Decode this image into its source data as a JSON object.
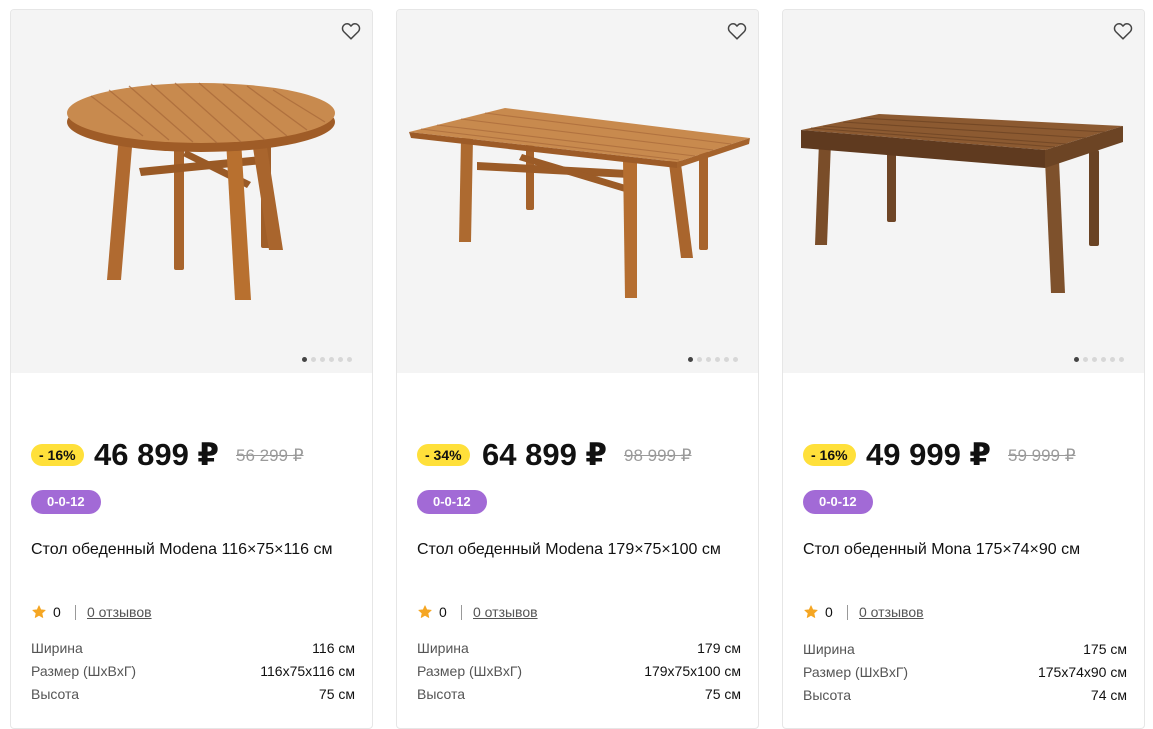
{
  "cards": [
    {
      "discount": "- 16%",
      "price": "46 899 ₽",
      "old_price": "56 299 ₽",
      "installment": "0-0-12",
      "title": "Стол обеденный Modena 116×75×116 см",
      "rating": "0",
      "reviews": "0 отзывов",
      "specs": [
        {
          "key": "Ширина",
          "value": "116 см"
        },
        {
          "key": "Размер (ШxВxГ)",
          "value": "116x75x116 см"
        },
        {
          "key": "Высота",
          "value": "75 см"
        }
      ],
      "image_icon": "round-wooden-table-image",
      "slides": 6,
      "active_slide": 1
    },
    {
      "discount": "- 34%",
      "price": "64 899 ₽",
      "old_price": "98 999 ₽",
      "installment": "0-0-12",
      "title": "Стол обеденный Modena 179×75×100 см",
      "rating": "0",
      "reviews": "0 отзывов",
      "specs": [
        {
          "key": "Ширина",
          "value": "179 см"
        },
        {
          "key": "Размер (ШxВxГ)",
          "value": "179x75x100 см"
        },
        {
          "key": "Высота",
          "value": "75 см"
        }
      ],
      "image_icon": "rectangular-wooden-table-image",
      "slides": 6,
      "active_slide": 1
    },
    {
      "discount": "- 16%",
      "price": "49 999 ₽",
      "old_price": "59 999 ₽",
      "installment": "0-0-12",
      "title": "Стол обеденный Mona 175×74×90 см",
      "rating": "0",
      "reviews": "0 отзывов",
      "specs": [
        {
          "key": "Ширина",
          "value": "175 см"
        },
        {
          "key": "Размер (ШxВxГ)",
          "value": "175x74x90 см"
        },
        {
          "key": "Высота",
          "value": "74 см"
        }
      ],
      "image_icon": "dark-wooden-table-image",
      "slides": 6,
      "active_slide": 1
    }
  ],
  "colors": {
    "discount_bg": "#ffe03a",
    "installment_bg": "#a26ad6",
    "star": "#f5a623",
    "photo_bg": "#f4f4f4"
  },
  "icons": [
    "heart-icon",
    "star-icon"
  ]
}
